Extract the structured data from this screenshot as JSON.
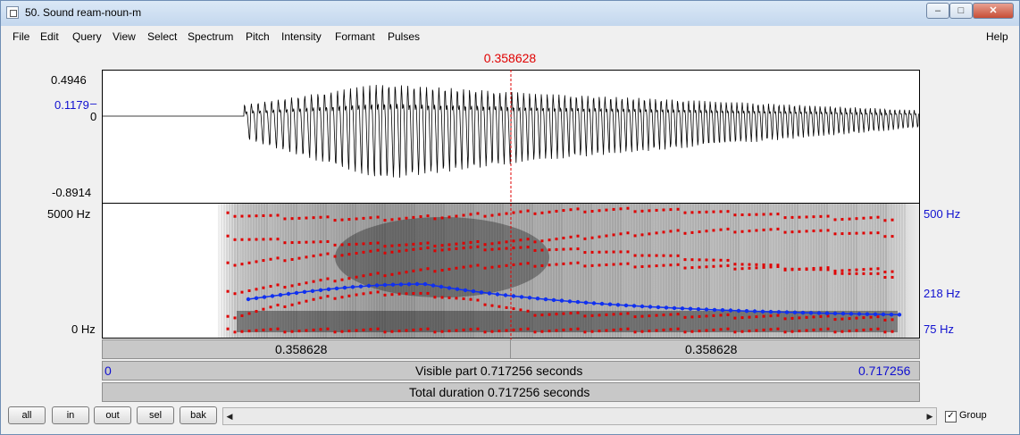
{
  "window": {
    "title": "50. Sound ream-noun-m",
    "min_label": "–",
    "max_label": "□",
    "close_label": "✕"
  },
  "menu": {
    "items": [
      "File",
      "Edit",
      "Query",
      "View",
      "Select",
      "Spectrum",
      "Pitch",
      "Intensity",
      "Formant",
      "Pulses"
    ],
    "help": "Help"
  },
  "cursor": {
    "time": "0.358628"
  },
  "waveform": {
    "max_label": "0.4946",
    "cursor_value": "0.1179",
    "zero_label": "0",
    "min_label": "-0.8914"
  },
  "spectrogram": {
    "freq_top": "5000 Hz",
    "freq_bottom": "0 Hz",
    "pitch_top": "500 Hz",
    "pitch_value": "218 Hz",
    "pitch_bottom": "75 Hz"
  },
  "time_bars": {
    "left_segment": "0.358628",
    "right_segment": "0.358628",
    "visible_start": "0",
    "visible_label": "Visible part 0.717256 seconds",
    "visible_end": "0.717256",
    "total_label": "Total duration 0.717256 seconds"
  },
  "buttons": {
    "all": "all",
    "in": "in",
    "out": "out",
    "sel": "sel",
    "bak": "bak",
    "scroll_left": "◀",
    "scroll_right": "▶",
    "group_checked": "✓",
    "group": "Group"
  },
  "colors": {
    "cursor": "#e00000",
    "pitch": "#1030f0",
    "formant": "#e00000",
    "axis_blue": "#1010d0"
  }
}
